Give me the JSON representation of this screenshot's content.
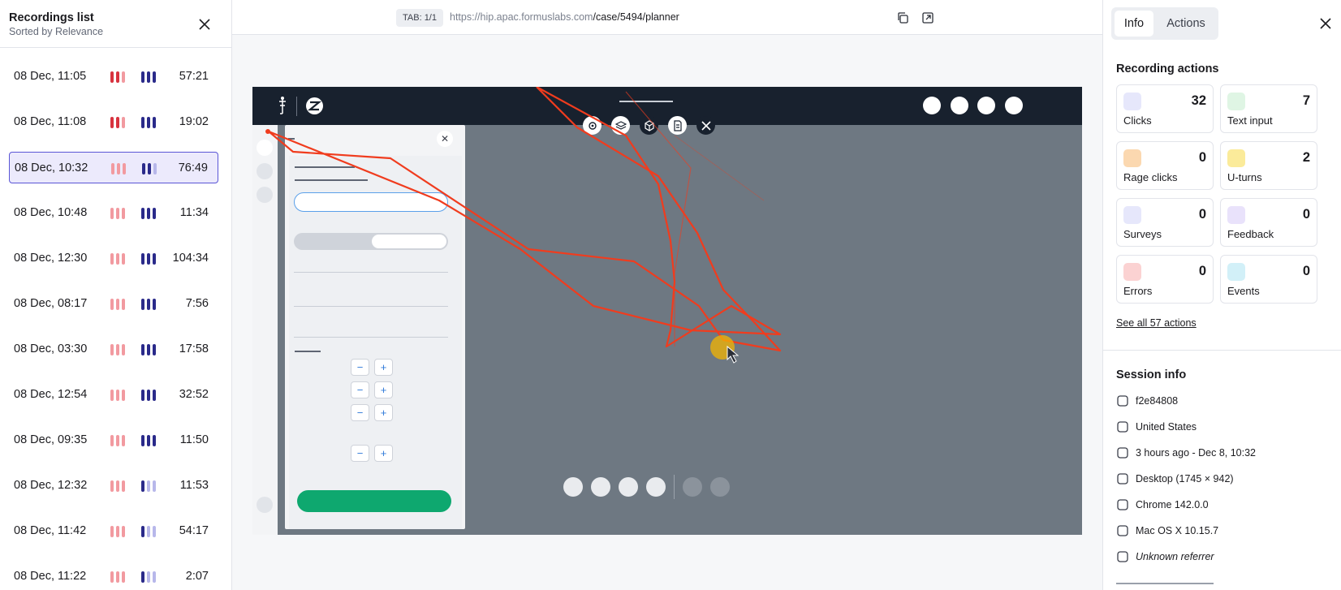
{
  "left_panel": {
    "title": "Recordings list",
    "subtitle": "Sorted by Relevance",
    "recordings": [
      {
        "date": "08 Dec, 11:05",
        "duration": "57:21",
        "selected": false,
        "strong_bars": true
      },
      {
        "date": "08 Dec, 11:08",
        "duration": "19:02",
        "selected": false,
        "strong_bars": true
      },
      {
        "date": "08 Dec, 10:32",
        "duration": "76:49",
        "selected": true,
        "strong_bars": false
      },
      {
        "date": "08 Dec, 10:48",
        "duration": "11:34",
        "selected": false,
        "strong_bars": false
      },
      {
        "date": "08 Dec, 12:30",
        "duration": "104:34",
        "selected": false,
        "strong_bars": false
      },
      {
        "date": "08 Dec, 08:17",
        "duration": "7:56",
        "selected": false,
        "strong_bars": false
      },
      {
        "date": "08 Dec, 03:30",
        "duration": "17:58",
        "selected": false,
        "strong_bars": false
      },
      {
        "date": "08 Dec, 12:54",
        "duration": "32:52",
        "selected": false,
        "strong_bars": false
      },
      {
        "date": "08 Dec, 09:35",
        "duration": "11:50",
        "selected": false,
        "strong_bars": false
      },
      {
        "date": "08 Dec, 12:32",
        "duration": "11:53",
        "selected": false,
        "strong_bars": false
      },
      {
        "date": "08 Dec, 11:42",
        "duration": "54:17",
        "selected": false,
        "strong_bars": false
      },
      {
        "date": "08 Dec, 11:22",
        "duration": "2:07",
        "selected": false,
        "strong_bars": false
      }
    ]
  },
  "topbar": {
    "tab_label": "TAB: 1/1",
    "url_host": "https://hip.apac.formuslabs.com",
    "url_path": "/case/5494/planner",
    "icons": [
      "copy-icon",
      "external-link-icon"
    ]
  },
  "right_panel": {
    "tabs": [
      "Info",
      "Actions"
    ],
    "active_tab": "Info",
    "recording_actions_title": "Recording actions",
    "stats": [
      {
        "label": "Clicks",
        "value": "32",
        "icon": "cursor-click-icon",
        "color": "#e6e7fb"
      },
      {
        "label": "Text input",
        "value": "7",
        "icon": "text-input-icon",
        "color": "#dff5e4"
      },
      {
        "label": "Rage clicks",
        "value": "0",
        "icon": "rage-face-icon",
        "color": "#fbd8b0"
      },
      {
        "label": "U-turns",
        "value": "2",
        "icon": "u-turn-icon",
        "color": "#fbeb9a"
      },
      {
        "label": "Surveys",
        "value": "0",
        "icon": "survey-clipboard-icon",
        "color": "#e6e7fb"
      },
      {
        "label": "Feedback",
        "value": "0",
        "icon": "feedback-chat-icon",
        "color": "#e9e2fb"
      },
      {
        "label": "Errors",
        "value": "0",
        "icon": "error-circle-icon",
        "color": "#fbd2d2"
      },
      {
        "label": "Events",
        "value": "0",
        "icon": "lightning-icon",
        "color": "#d2f0f8"
      }
    ],
    "see_all": "See all 57 actions",
    "session_info_title": "Session info",
    "session_info": [
      {
        "icon": "user-icon",
        "text": "f2e84808"
      },
      {
        "icon": "us-flag-icon",
        "text": "United States"
      },
      {
        "icon": "calendar-icon",
        "text": "3 hours ago - Dec 8, 10:32"
      },
      {
        "icon": "monitor-icon",
        "text": "Desktop (1745 × 942)"
      },
      {
        "icon": "chrome-icon",
        "text": "Chrome 142.0.0"
      },
      {
        "icon": "apple-icon",
        "text": "Mac OS X 10.15.7"
      },
      {
        "icon": "referrer-arrow-icon",
        "text": "Unknown referrer"
      }
    ]
  },
  "colors": {
    "accent": "#5a55d6",
    "trail": "#f03c1e",
    "green_button": "#0ea86f",
    "app_header": "#18212e"
  }
}
